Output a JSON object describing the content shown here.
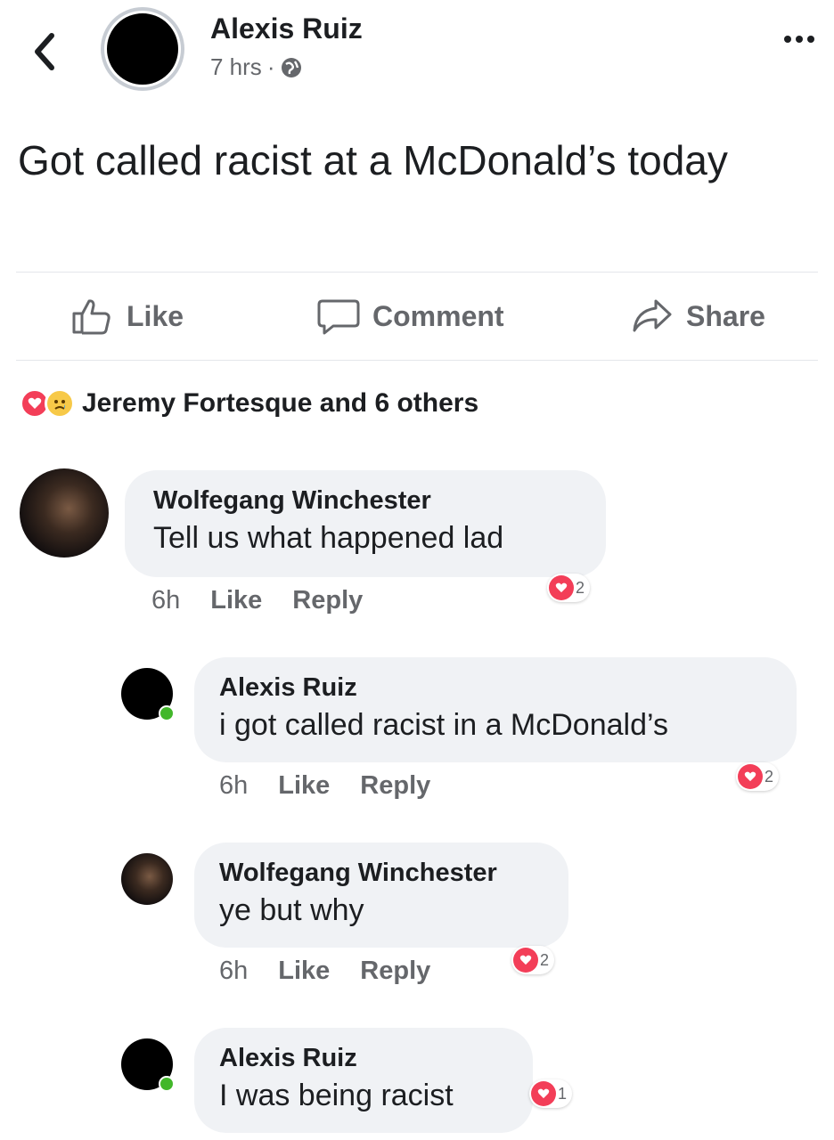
{
  "post": {
    "author": "Alexis Ruiz",
    "time": "7 hrs",
    "separator": "·",
    "privacy_icon": "globe-icon",
    "text": "Got called racist at a McDonald’s today"
  },
  "actions": {
    "like": "Like",
    "comment": "Comment",
    "share": "Share"
  },
  "reactions": {
    "summary": "Jeremy Fortesque and 6 others",
    "types": [
      "love",
      "sad"
    ]
  },
  "comments": [
    {
      "author": "Wolfegang Winchester",
      "text": "Tell us what happened lad",
      "time": "6h",
      "like": "Like",
      "reply": "Reply",
      "reaction_count": "2"
    },
    {
      "author": "Alexis Ruiz",
      "text": "i got called racist in a McDonald’s",
      "time": "6h",
      "like": "Like",
      "reply": "Reply",
      "reaction_count": "2"
    },
    {
      "author": "Wolfegang Winchester",
      "text": "ye but why",
      "time": "6h",
      "like": "Like",
      "reply": "Reply",
      "reaction_count": "2"
    },
    {
      "author": "Alexis Ruiz",
      "text": "I was being racist",
      "reaction_count": "1"
    }
  ],
  "colors": {
    "love": "#f33e58",
    "sad": "#f7c948",
    "bubble": "#f0f2f5",
    "muted": "#65676b",
    "online": "#42b72a"
  }
}
